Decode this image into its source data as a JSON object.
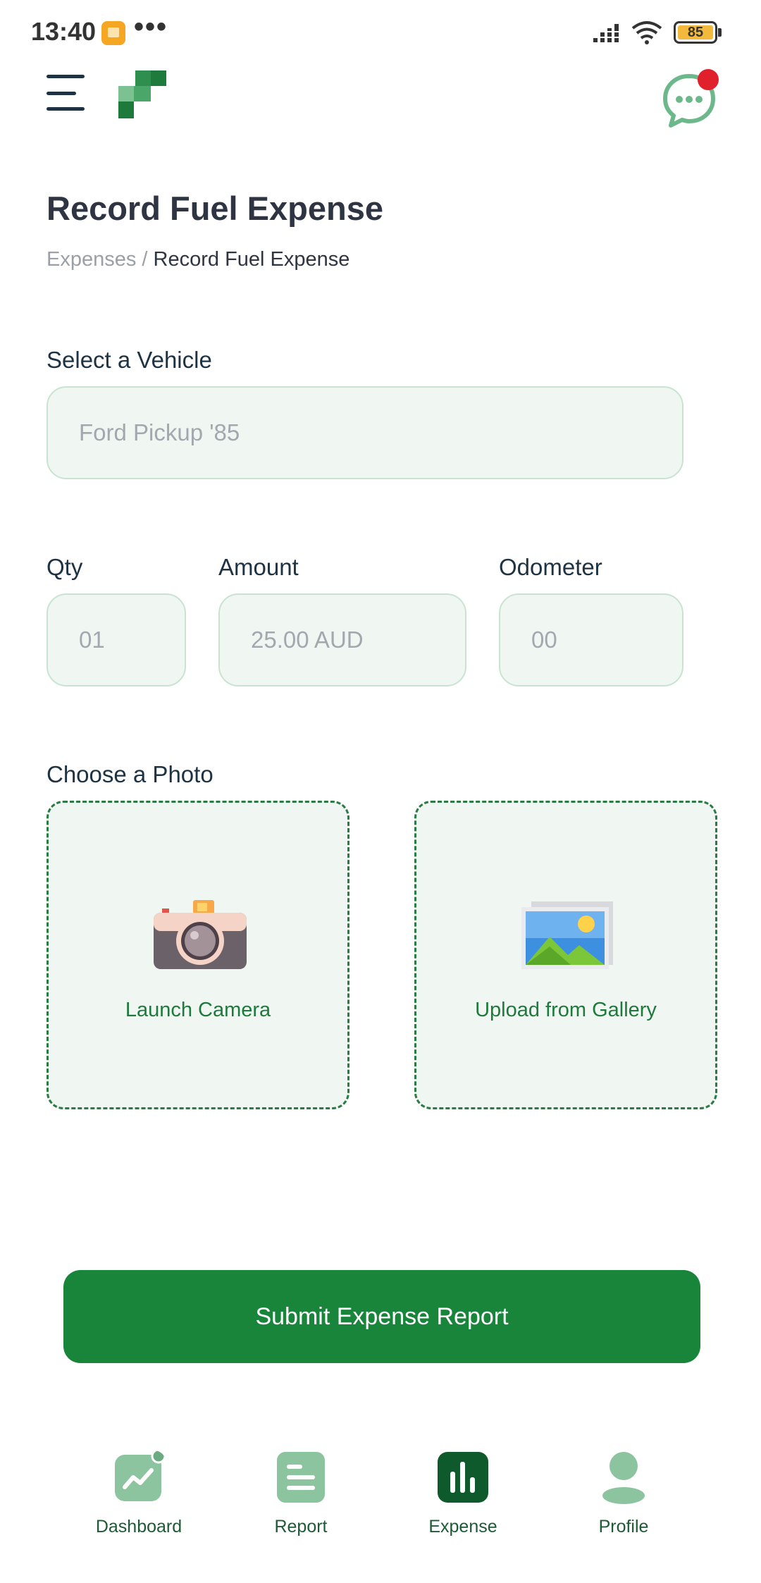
{
  "status_bar": {
    "time": "13:40",
    "dots": "•••",
    "battery": "85"
  },
  "header": {
    "menu_icon": "menu-icon",
    "logo": "logo-mark",
    "chat_icon": "chat-icon",
    "has_notification": true
  },
  "page": {
    "title": "Record Fuel Expense",
    "breadcrumb": {
      "parent": "Expenses",
      "separator": " / ",
      "current": "Record Fuel Expense"
    }
  },
  "form": {
    "vehicle": {
      "label": "Select a Vehicle",
      "placeholder": "Ford Pickup '85"
    },
    "qty": {
      "label": "Qty",
      "placeholder": "01"
    },
    "amount": {
      "label": "Amount",
      "placeholder": "25.00 AUD"
    },
    "odometer": {
      "label": "Odometer",
      "placeholder": "00"
    },
    "photo": {
      "label": "Choose a Photo",
      "camera_label": "Launch Camera",
      "gallery_label": "Upload from Gallery"
    },
    "submit_label": "Submit Expense Report"
  },
  "bottom_nav": {
    "items": [
      {
        "label": "Dashboard",
        "icon": "dashboard-icon",
        "active": false
      },
      {
        "label": "Report",
        "icon": "report-icon",
        "active": false
      },
      {
        "label": "Expense",
        "icon": "expense-icon",
        "active": true
      },
      {
        "label": "Profile",
        "icon": "profile-icon",
        "active": false
      }
    ]
  },
  "colors": {
    "primary": "#18853a",
    "primary_dark": "#0f5a2c",
    "nav_inactive": "#8cc49f",
    "field_bg": "#f0f7f2",
    "badge": "#e0202a"
  }
}
